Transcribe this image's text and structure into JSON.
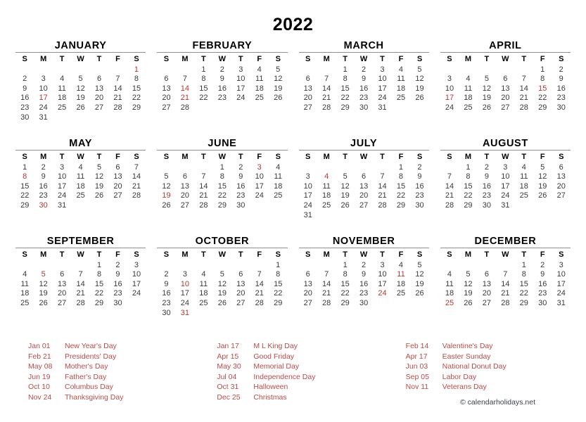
{
  "title": "2022",
  "colors": {
    "holiday_red": "#b5382f",
    "holiday_list_red": "#bc4a47",
    "text": "#3a3a3a",
    "heading": "#000000",
    "rule": "#8f8f8f",
    "footer": "#3c4050",
    "background": "#ffffff"
  },
  "weekday_headers": [
    "S",
    "M",
    "T",
    "W",
    "T",
    "F",
    "S"
  ],
  "months": [
    {
      "name": "JANUARY",
      "weeks": [
        [
          "",
          "",
          "",
          "",
          "",
          "",
          "1"
        ],
        [
          "2",
          "3",
          "4",
          "5",
          "6",
          "7",
          "8"
        ],
        [
          "9",
          "10",
          "11",
          "12",
          "13",
          "14",
          "15"
        ],
        [
          "16",
          "17",
          "18",
          "19",
          "20",
          "21",
          "22"
        ],
        [
          "23",
          "24",
          "25",
          "26",
          "27",
          "28",
          "29"
        ],
        [
          "30",
          "31",
          "",
          "",
          "",
          "",
          ""
        ]
      ],
      "holidays": [
        1,
        17
      ]
    },
    {
      "name": "FEBRUARY",
      "weeks": [
        [
          "",
          "",
          "1",
          "2",
          "3",
          "4",
          "5"
        ],
        [
          "6",
          "7",
          "8",
          "9",
          "10",
          "11",
          "12"
        ],
        [
          "13",
          "14",
          "15",
          "16",
          "17",
          "18",
          "19"
        ],
        [
          "20",
          "21",
          "22",
          "23",
          "24",
          "25",
          "26"
        ],
        [
          "27",
          "28",
          "",
          "",
          "",
          "",
          ""
        ],
        [
          "",
          "",
          "",
          "",
          "",
          "",
          ""
        ]
      ],
      "holidays": [
        14,
        21
      ]
    },
    {
      "name": "MARCH",
      "weeks": [
        [
          "",
          "",
          "1",
          "2",
          "3",
          "4",
          "5"
        ],
        [
          "6",
          "7",
          "8",
          "9",
          "10",
          "11",
          "12"
        ],
        [
          "13",
          "14",
          "15",
          "16",
          "17",
          "18",
          "19"
        ],
        [
          "20",
          "21",
          "22",
          "23",
          "24",
          "25",
          "26"
        ],
        [
          "27",
          "28",
          "29",
          "30",
          "31",
          "",
          ""
        ],
        [
          "",
          "",
          "",
          "",
          "",
          "",
          ""
        ]
      ],
      "holidays": []
    },
    {
      "name": "APRIL",
      "weeks": [
        [
          "",
          "",
          "",
          "",
          "",
          "1",
          "2"
        ],
        [
          "3",
          "4",
          "5",
          "6",
          "7",
          "8",
          "9"
        ],
        [
          "10",
          "11",
          "12",
          "13",
          "14",
          "15",
          "16"
        ],
        [
          "17",
          "18",
          "19",
          "20",
          "21",
          "22",
          "23"
        ],
        [
          "24",
          "25",
          "26",
          "27",
          "28",
          "29",
          "30"
        ],
        [
          "",
          "",
          "",
          "",
          "",
          "",
          ""
        ]
      ],
      "holidays": [
        15,
        17
      ]
    },
    {
      "name": "MAY",
      "weeks": [
        [
          "1",
          "2",
          "3",
          "4",
          "5",
          "6",
          "7"
        ],
        [
          "8",
          "9",
          "10",
          "11",
          "12",
          "13",
          "14"
        ],
        [
          "15",
          "16",
          "17",
          "18",
          "19",
          "20",
          "21"
        ],
        [
          "22",
          "23",
          "24",
          "25",
          "26",
          "27",
          "28"
        ],
        [
          "29",
          "30",
          "31",
          "",
          "",
          "",
          ""
        ],
        [
          "",
          "",
          "",
          "",
          "",
          "",
          ""
        ]
      ],
      "holidays": [
        8,
        30
      ]
    },
    {
      "name": "JUNE",
      "weeks": [
        [
          "",
          "",
          "",
          "1",
          "2",
          "3",
          "4"
        ],
        [
          "5",
          "6",
          "7",
          "8",
          "9",
          "10",
          "11"
        ],
        [
          "12",
          "13",
          "14",
          "15",
          "16",
          "17",
          "18"
        ],
        [
          "19",
          "20",
          "21",
          "22",
          "23",
          "24",
          "25"
        ],
        [
          "26",
          "27",
          "28",
          "29",
          "30",
          "",
          ""
        ],
        [
          "",
          "",
          "",
          "",
          "",
          "",
          ""
        ]
      ],
      "holidays": [
        3,
        19
      ]
    },
    {
      "name": "JULY",
      "weeks": [
        [
          "",
          "",
          "",
          "",
          "",
          "1",
          "2"
        ],
        [
          "3",
          "4",
          "5",
          "6",
          "7",
          "8",
          "9"
        ],
        [
          "10",
          "11",
          "12",
          "13",
          "14",
          "15",
          "16"
        ],
        [
          "17",
          "18",
          "19",
          "20",
          "21",
          "22",
          "23"
        ],
        [
          "24",
          "25",
          "26",
          "27",
          "28",
          "29",
          "30"
        ],
        [
          "31",
          "",
          "",
          "",
          "",
          "",
          ""
        ]
      ],
      "holidays": [
        4
      ]
    },
    {
      "name": "AUGUST",
      "weeks": [
        [
          "",
          "1",
          "2",
          "3",
          "4",
          "5",
          "6"
        ],
        [
          "7",
          "8",
          "9",
          "10",
          "11",
          "12",
          "13"
        ],
        [
          "14",
          "15",
          "16",
          "17",
          "18",
          "19",
          "20"
        ],
        [
          "21",
          "22",
          "23",
          "24",
          "25",
          "26",
          "27"
        ],
        [
          "28",
          "29",
          "30",
          "31",
          "",
          "",
          ""
        ],
        [
          "",
          "",
          "",
          "",
          "",
          "",
          ""
        ]
      ],
      "holidays": []
    },
    {
      "name": "SEPTEMBER",
      "weeks": [
        [
          "",
          "",
          "",
          "",
          "1",
          "2",
          "3"
        ],
        [
          "4",
          "5",
          "6",
          "7",
          "8",
          "9",
          "10"
        ],
        [
          "11",
          "12",
          "13",
          "14",
          "15",
          "16",
          "17"
        ],
        [
          "18",
          "19",
          "20",
          "21",
          "22",
          "23",
          "24"
        ],
        [
          "25",
          "26",
          "27",
          "28",
          "29",
          "30",
          ""
        ],
        [
          "",
          "",
          "",
          "",
          "",
          "",
          ""
        ]
      ],
      "holidays": [
        5
      ]
    },
    {
      "name": "OCTOBER",
      "weeks": [
        [
          "",
          "",
          "",
          "",
          "",
          "",
          "1"
        ],
        [
          "2",
          "3",
          "4",
          "5",
          "6",
          "7",
          "8"
        ],
        [
          "9",
          "10",
          "11",
          "12",
          "13",
          "14",
          "15"
        ],
        [
          "16",
          "17",
          "18",
          "19",
          "20",
          "21",
          "22"
        ],
        [
          "23",
          "24",
          "25",
          "26",
          "27",
          "28",
          "29"
        ],
        [
          "30",
          "31",
          "",
          "",
          "",
          "",
          ""
        ]
      ],
      "holidays": [
        10,
        31
      ]
    },
    {
      "name": "NOVEMBER",
      "weeks": [
        [
          "",
          "",
          "1",
          "2",
          "3",
          "4",
          "5"
        ],
        [
          "6",
          "7",
          "8",
          "9",
          "10",
          "11",
          "12"
        ],
        [
          "13",
          "14",
          "15",
          "16",
          "17",
          "18",
          "19"
        ],
        [
          "20",
          "21",
          "22",
          "23",
          "24",
          "25",
          "26"
        ],
        [
          "27",
          "28",
          "29",
          "30",
          "",
          "",
          ""
        ],
        [
          "",
          "",
          "",
          "",
          "",
          "",
          ""
        ]
      ],
      "holidays": [
        11,
        24
      ]
    },
    {
      "name": "DECEMBER",
      "weeks": [
        [
          "",
          "",
          "",
          "",
          "1",
          "2",
          "3"
        ],
        [
          "4",
          "5",
          "6",
          "7",
          "8",
          "9",
          "10"
        ],
        [
          "11",
          "12",
          "13",
          "14",
          "15",
          "16",
          "17"
        ],
        [
          "18",
          "19",
          "20",
          "21",
          "22",
          "23",
          "24"
        ],
        [
          "25",
          "26",
          "27",
          "28",
          "29",
          "30",
          "31"
        ],
        [
          "",
          "",
          "",
          "",
          "",
          "",
          ""
        ]
      ],
      "holidays": [
        25
      ]
    }
  ],
  "holiday_columns": [
    [
      {
        "date": "Jan 01",
        "name": "New Year's Day"
      },
      {
        "date": "Feb 21",
        "name": "Presidents' Day"
      },
      {
        "date": "May 08",
        "name": "Mother's Day"
      },
      {
        "date": "Jun 19",
        "name": "Father's Day"
      },
      {
        "date": "Oct 10",
        "name": "Columbus Day"
      },
      {
        "date": "Nov 24",
        "name": "Thanksgiving Day"
      }
    ],
    [
      {
        "date": "Jan 17",
        "name": "M L King Day"
      },
      {
        "date": "Apr 15",
        "name": "Good Friday"
      },
      {
        "date": "May 30",
        "name": "Memorial Day"
      },
      {
        "date": "Jul 04",
        "name": "Independence Day"
      },
      {
        "date": "Oct 31",
        "name": "Halloween"
      },
      {
        "date": "Dec 25",
        "name": "Christmas"
      }
    ],
    [
      {
        "date": "Feb 14",
        "name": "Valentine's Day"
      },
      {
        "date": "Apr 17",
        "name": "Easter Sunday"
      },
      {
        "date": "Jun 03",
        "name": "National Donut Day"
      },
      {
        "date": "Sep 05",
        "name": "Labor Day"
      },
      {
        "date": "Nov 11",
        "name": "Veterans Day"
      }
    ]
  ],
  "footer": "© calendarholidays.net"
}
